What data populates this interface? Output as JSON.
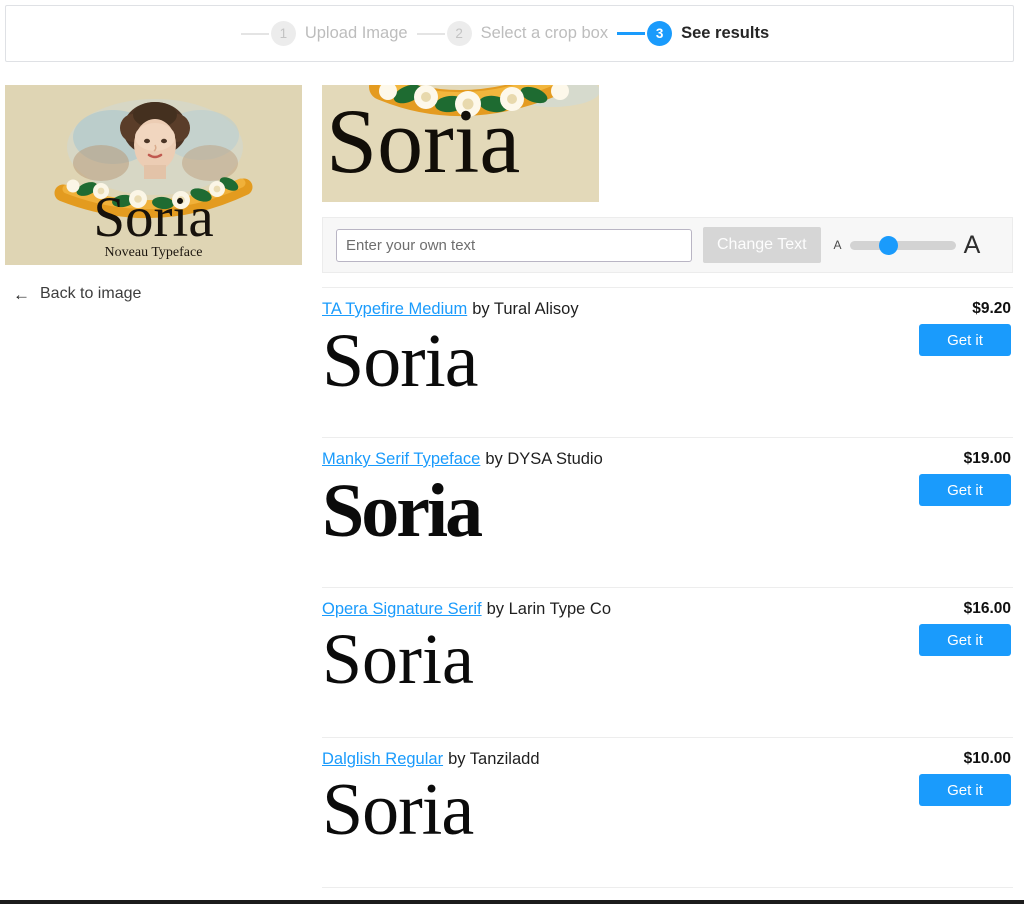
{
  "stepper": {
    "steps": [
      {
        "number": "1",
        "label": "Upload Image",
        "state": "done"
      },
      {
        "number": "2",
        "label": "Select a crop box",
        "state": "done"
      },
      {
        "number": "3",
        "label": "See results",
        "state": "active"
      }
    ],
    "active_color": "#1a9bfc",
    "inactive_color": "#bdbdbd"
  },
  "left_panel": {
    "thumbnail": {
      "word": "Soria",
      "subtitle": "Noveau Typeface",
      "background_color": "#dfd5b4",
      "alt": "vintage cigar label illustration of a woman with flower garland"
    },
    "back_link": {
      "label": "Back to image",
      "icon": "arrow-left-icon"
    }
  },
  "right_panel": {
    "crop_preview": {
      "word": "Soria",
      "background_color": "#e3d9b9"
    },
    "toolbar": {
      "input_placeholder": "Enter your own text",
      "input_value": "",
      "change_text_label": "Change Text",
      "size_slider": {
        "small_label": "A",
        "large_label": "A",
        "value_percent": 33,
        "thumb_color": "#1a9bfc",
        "track_color": "#d3d3d3"
      }
    },
    "results": [
      {
        "font_name": "TA Typefire Medium",
        "by": "by Tural Alisoy",
        "price": "$9.20",
        "button_label": "Get it",
        "specimen": "Soria"
      },
      {
        "font_name": "Manky Serif Typeface",
        "by": "by DYSA Studio",
        "price": "$19.00",
        "button_label": "Get it",
        "specimen": "Soria"
      },
      {
        "font_name": "Opera Signature Serif",
        "by": "by Larin Type Co",
        "price": "$16.00",
        "button_label": "Get it",
        "specimen": "Soria"
      },
      {
        "font_name": "Dalglish Regular",
        "by": "by Tanziladd",
        "price": "$10.00",
        "button_label": "Get it",
        "specimen": "Soria"
      }
    ]
  }
}
